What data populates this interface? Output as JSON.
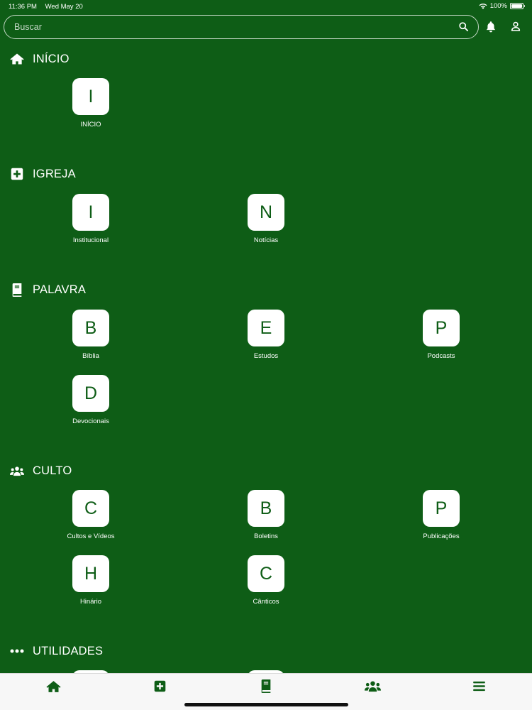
{
  "status_bar": {
    "time": "11:36 PM",
    "date": "Wed May 20",
    "battery": "100%",
    "battery_level": 1.0
  },
  "search": {
    "placeholder": "Buscar"
  },
  "icons": {
    "notifications": "bell-icon",
    "profile": "user-icon",
    "search": "search-icon"
  },
  "colors": {
    "background": "#0e5d16",
    "tile": "#ffffff",
    "tab_bar": "#f7f7f7",
    "accent": "#0e5d16"
  },
  "sections": [
    {
      "title": "INÍCIO",
      "icon": "home-icon",
      "items": [
        {
          "letter": "I",
          "label": "INÍCIO"
        }
      ]
    },
    {
      "title": "IGREJA",
      "icon": "plus-square-icon",
      "items": [
        {
          "letter": "I",
          "label": "Institucional"
        },
        {
          "letter": "N",
          "label": "Notícias"
        }
      ]
    },
    {
      "title": "PALAVRA",
      "icon": "book-icon",
      "items": [
        {
          "letter": "B",
          "label": "Bíblia"
        },
        {
          "letter": "E",
          "label": "Estudos"
        },
        {
          "letter": "P",
          "label": "Podcasts"
        },
        {
          "letter": "D",
          "label": "Devocionais"
        }
      ]
    },
    {
      "title": "CULTO",
      "icon": "users-icon",
      "items": [
        {
          "letter": "C",
          "label": "Cultos e Vídeos"
        },
        {
          "letter": "B",
          "label": "Boletins"
        },
        {
          "letter": "P",
          "label": "Publicações"
        },
        {
          "letter": "H",
          "label": "Hinário"
        },
        {
          "letter": "C",
          "label": "Cânticos"
        }
      ]
    },
    {
      "title": "UTILIDADES",
      "icon": "ellipsis-icon",
      "items": []
    }
  ],
  "tab_bar": [
    {
      "icon": "home-icon",
      "active": true
    },
    {
      "icon": "plus-square-icon",
      "active": false
    },
    {
      "icon": "book-icon",
      "active": false
    },
    {
      "icon": "users-icon",
      "active": false
    },
    {
      "icon": "menu-icon",
      "active": false
    }
  ]
}
